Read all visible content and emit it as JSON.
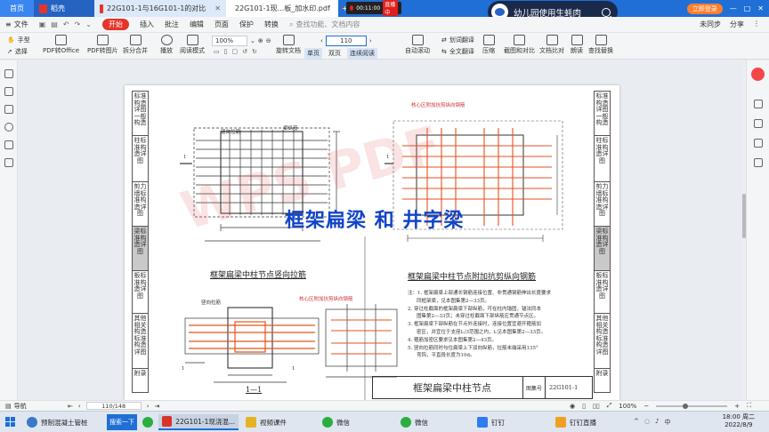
{
  "tabbar": {
    "tabs": [
      {
        "label": "首页",
        "kind": "home"
      },
      {
        "label": "稻壳",
        "kind": "dark"
      },
      {
        "label": "22G101-1与16G101-1的对比",
        "kind": "light"
      },
      {
        "label": "22G101-1现...板_加水印.pdf",
        "kind": "active"
      }
    ],
    "recorder": {
      "time": "00:11:00",
      "live": "直播中"
    },
    "login": "立即登录"
  },
  "overlay": {
    "title": "幼儿园使用生蚝肉"
  },
  "menubar": {
    "file": "文件",
    "items": [
      "开始",
      "插入",
      "批注",
      "编辑",
      "页面",
      "保护",
      "转换"
    ],
    "search": "查找功能、文档内容",
    "right": [
      "未同步",
      "分享"
    ]
  },
  "toolbar": {
    "hand": "手型",
    "select": "选择",
    "pdf_office": "PDF转Office",
    "pdf_image": "PDF转图片",
    "split_merge": "拆分合并",
    "play": "播放",
    "read_mode": "阅读模式",
    "zoom": "100%",
    "page_input": "110",
    "rotate": "旋转文档",
    "single": "单页",
    "double": "双页",
    "continuous": "连续阅读",
    "auto_scroll": "自动滚动",
    "word_translate": "划词翻译",
    "full_translate": "全文翻译",
    "compress": "压缩",
    "screenshot_compare": "截图和对比",
    "doc_compare": "文档比对",
    "read_aloud": "朗读",
    "find_replace": "查找替换"
  },
  "page": {
    "col_tabs_left": [
      "标准构造详图一般构造",
      "柱标准构造详图",
      "剪力墙标准构造详图",
      "梁标准构造详图",
      "板标准构造详图",
      "其他相关构造标准构造详图",
      "附录"
    ],
    "col_tabs_right": [
      "标准构造详图一般构造",
      "柱标准构造详图",
      "剪力墙标准构造详图",
      "梁标准构造详图",
      "板标准构造详图",
      "其他相关构造标准构造详图",
      "附录"
    ],
    "overlay_title": "框架扁梁 和 井字梁",
    "watermark": "WPS PDF",
    "caption_left": "框架扁梁中柱节点竖向拉筋",
    "caption_right": "框架扁梁中柱节点附加抗剪纵向钢筋",
    "section_label": "1—1",
    "labels": {
      "vertical_tie": "竖向拉筋",
      "beam_long": "梁纵筋",
      "core_added": "核心区附加抗剪纵向钢筋",
      "core_added2": "核心区附加抗剪纵向钢筋",
      "vertical_tie2": "竖向拉筋",
      "marker1": "1",
      "marker2": "1",
      "marker3": "1",
      "marker4": "1"
    },
    "notes": [
      "注：1. 框架扁梁上部通长钢筋连接位置、非贯通钢筋伸出长度要求",
      "同框架梁，见本图集第2—33页。",
      "2. 穿过柱截面的框架扁梁下部纵筋，可在柱内锚固，锚法同本",
      "图集第2—33页；未穿过柱截面下部纵筋应贯通节点区。",
      "3. 框架扁梁下部纵筋在节点外连接时，连接位置宜避开箍筋加",
      "密区，并宜位于支座lₙ/3范围之内，lₙ见本图集第2—33页。",
      "4. 箍筋加密区要求见本图集第2—43页。",
      "5. 竖向拉筋同时勾住扁梁上下双向纵筋，拉筋末端采用135°",
      "弯钩，平直段长度为10d。"
    ],
    "title_block": {
      "title": "框架扁梁中柱节点",
      "label": "图集号",
      "code": "22G101-1"
    }
  },
  "statusbar": {
    "nav": "导航",
    "page": "110/148",
    "zoom": "100%"
  },
  "taskbar": {
    "items": [
      {
        "label": "预制混凝土管桩",
        "color": "#3a78c8"
      },
      {
        "label": "22G101-1现浇混...",
        "color": "#d9332a"
      },
      {
        "label": "视频课件",
        "color": "#e5b323"
      },
      {
        "label": "微信",
        "color": "#2aae3e"
      },
      {
        "label": "微信",
        "color": "#2aae3e"
      },
      {
        "label": "钉钉",
        "color": "#2f7bf2"
      },
      {
        "label": "钉钉直播",
        "color": "#f0a020"
      }
    ],
    "search": "搜索一下",
    "time": "18:00 周二",
    "date": "2022/8/9"
  }
}
